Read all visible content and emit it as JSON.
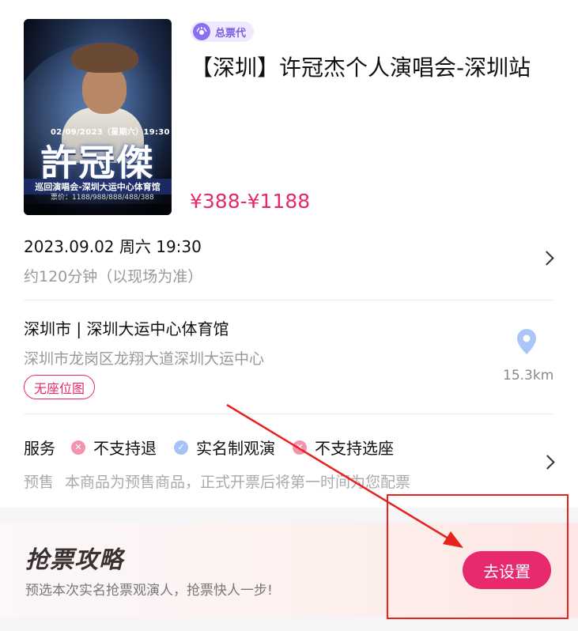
{
  "event": {
    "badge": "总票代",
    "title": "【深圳】许冠杰个人演唱会-深圳站",
    "price": "¥388-¥1188",
    "poster": {
      "date": "02/09/2023（星期六）19:30",
      "name": "許冠傑",
      "tour": "巡回演唱会-深圳大运中心体育馆",
      "price": "票价：1188/988/888/488/388"
    }
  },
  "schedule": {
    "datetime": "2023.09.02 周六 19:30",
    "duration": "约120分钟（以现场为准）"
  },
  "venue": {
    "name": "深圳市 | 深圳大运中心体育馆",
    "address": "深圳市龙岗区龙翔大道深圳大运中心",
    "seat_map_tag": "无座位图",
    "distance": "15.3km"
  },
  "service": {
    "label": "服务",
    "items": [
      {
        "label": "不支持退",
        "status": "no"
      },
      {
        "label": "实名制观演",
        "status": "yes"
      },
      {
        "label": "不支持选座",
        "status": "no"
      }
    ],
    "presale_label": "预售",
    "presale_text": "本商品为预售商品，正式开票后将第一时间为您配票"
  },
  "banner": {
    "title": "抢票攻略",
    "subtitle": "预选本次实名抢票观演人，抢票快人一步!",
    "button": "去设置"
  },
  "colors": {
    "accent": "#e8296e",
    "badge": "#7a5de0",
    "annotation": "#e8231f"
  }
}
